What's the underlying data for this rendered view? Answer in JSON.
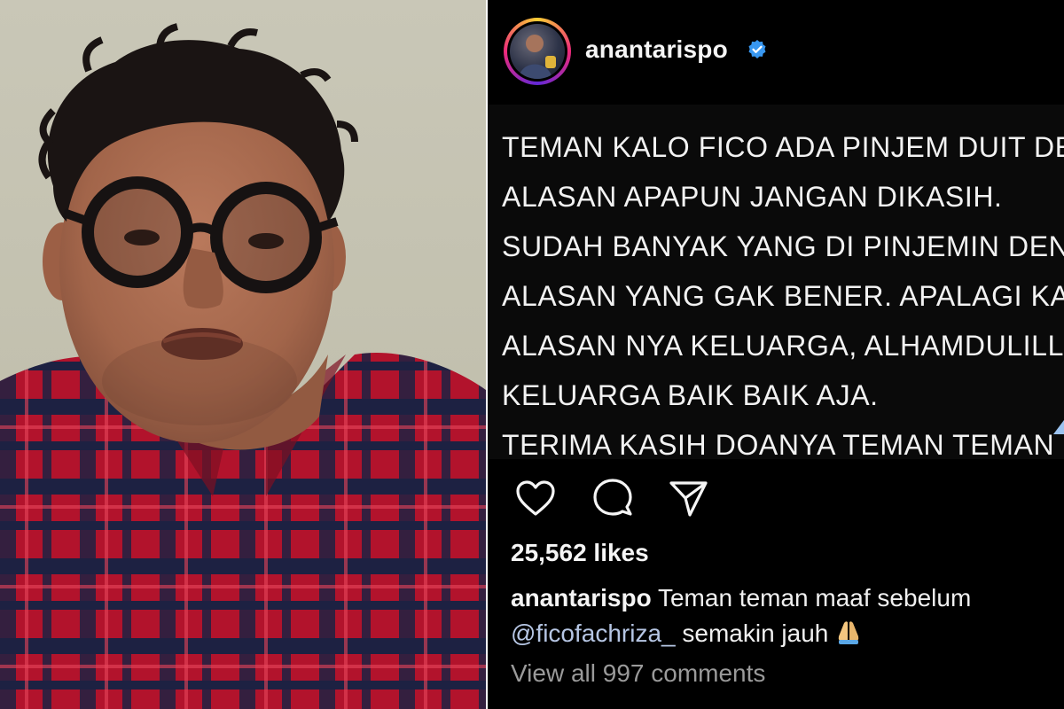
{
  "post": {
    "username": "anantarispo",
    "verified": true,
    "image_text_lines": [
      "TEMAN KALO FICO ADA PINJEM DUIT DEN",
      "ALASAN APAPUN JANGAN DIKASIH.",
      "SUDAH BANYAK YANG DI PINJEMIN DENG",
      "ALASAN YANG GAK BENER. APALAGI KAL",
      "ALASAN NYA KELUARGA, ALHAMDULILLA",
      "KELUARGA BAIK BAIK AJA.",
      "TERIMA KASIH DOANYA TEMAN TEMAN"
    ],
    "likes": "25,562 likes",
    "caption_user": "anantarispo",
    "caption_text": "Teman teman maaf sebelum",
    "caption_mention": "@ficofachriza_",
    "caption_text2": "semakin jauh",
    "view_comments": "View all 997 comments"
  },
  "icons": {
    "like": "heart-icon",
    "comment": "comment-bubble-icon",
    "share": "paper-plane-icon",
    "verified": "verified-badge-icon",
    "emoji": "folded-hands-icon"
  },
  "colors": {
    "background": "#000000",
    "text": "#f5f5f5",
    "verified": "#3897f0",
    "mention": "#b6c6e4",
    "muted": "#9a9a9a"
  }
}
